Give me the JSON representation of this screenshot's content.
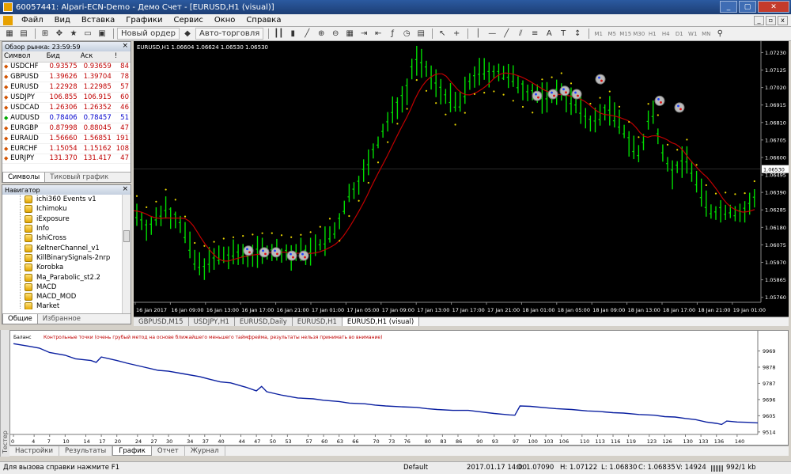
{
  "window": {
    "title": "60057441: Alpari-ECN-Demo - Демо Счет - [EURUSD,H1 (visual)]",
    "controls": [
      "_",
      "▢",
      "✕"
    ]
  },
  "menu": {
    "items": [
      "Файл",
      "Вид",
      "Вставка",
      "Графики",
      "Сервис",
      "Окно",
      "Справка"
    ],
    "mdi": [
      "_",
      "▫",
      "x"
    ]
  },
  "toolbar": {
    "new_order": "Новый ордер",
    "autotrade": "Авто-торговля",
    "timeframes": [
      "M1",
      "M5",
      "M15",
      "M30",
      "H1",
      "H4",
      "D1",
      "W1",
      "MN"
    ]
  },
  "market_watch": {
    "header": "Обзор рынка: 23:59:59",
    "columns": [
      "Символ",
      "Бид",
      "Аск",
      "!"
    ],
    "rows": [
      {
        "symbol": "USDCHF",
        "bid": "0.93575",
        "ask": "0.93659",
        "spread": "84"
      },
      {
        "symbol": "GBPUSD",
        "bid": "1.39626",
        "ask": "1.39704",
        "spread": "78"
      },
      {
        "symbol": "EURUSD",
        "bid": "1.22928",
        "ask": "1.22985",
        "spread": "57"
      },
      {
        "symbol": "USDJPY",
        "bid": "106.855",
        "ask": "106.915",
        "spread": "60"
      },
      {
        "symbol": "USDCAD",
        "bid": "1.26306",
        "ask": "1.26352",
        "spread": "46"
      },
      {
        "symbol": "AUDUSD",
        "bid": "0.78406",
        "ask": "0.78457",
        "spread": "51"
      },
      {
        "symbol": "EURGBP",
        "bid": "0.87998",
        "ask": "0.88045",
        "spread": "47"
      },
      {
        "symbol": "EURAUD",
        "bid": "1.56660",
        "ask": "1.56851",
        "spread": "191"
      },
      {
        "symbol": "EURCHF",
        "bid": "1.15054",
        "ask": "1.15162",
        "spread": "108"
      },
      {
        "symbol": "EURJPY",
        "bid": "131.370",
        "ask": "131.417",
        "spread": "47"
      }
    ],
    "tabs": [
      "Символы",
      "Тиковый график"
    ]
  },
  "navigator": {
    "header": "Навигатор",
    "items": [
      "ichi360 Events v1",
      "Ichimoku",
      "iExposure",
      "Info",
      "IshiCross",
      "KeltnerChannel_v1",
      "KillBinarySignals-2nrp",
      "Korobka",
      "Ma_Parabolic_st2.2",
      "MACD",
      "MACD_MOD",
      "Market"
    ],
    "tabs": [
      "Общие",
      "Избранное"
    ]
  },
  "chart": {
    "info": "EURUSD,H1  1.06604 1.06624 1.06530 1.06530",
    "price_labels": [
      "1.07230",
      "1.07125",
      "1.07020",
      "1.06915",
      "1.06810",
      "1.06705",
      "1.06600",
      "1.06530",
      "1.06495",
      "1.06390",
      "1.06285",
      "1.06180",
      "1.06075",
      "1.05970",
      "1.05865",
      "1.05760"
    ],
    "current_price": "1.06530",
    "time_labels": [
      "16 Jan 2017",
      "16 Jan 09:00",
      "16 Jan 13:00",
      "16 Jan 17:00",
      "16 Jan 21:00",
      "17 Jan 01:00",
      "17 Jan 05:00",
      "17 Jan 09:00",
      "17 Jan 13:00",
      "17 Jan 17:00",
      "17 Jan 21:00",
      "18 Jan 01:00",
      "18 Jan 05:00",
      "18 Jan 09:00",
      "18 Jan 13:00",
      "18 Jan 17:00",
      "18 Jan 21:00",
      "19 Jan 01:00"
    ],
    "colors": {
      "bg": "#000000",
      "candle": "#00dd00",
      "ma": "#c00000",
      "psar": "#e8d400",
      "trend": "#2040ff"
    },
    "tabs": [
      "GBPUSD,M15",
      "USDJPY,H1",
      "EURUSD,Daily",
      "EURUSD,H1",
      "EURUSD,H1 (visual)"
    ]
  },
  "chart_data": {
    "type": "line",
    "title": "Баланс",
    "note": "Контрольные точки (очень грубый метод на основе ближайшего меньшего таймфрейма, результаты нельзя принимать во внимание)",
    "x_ticks": [
      "0",
      "4",
      "7",
      "10",
      "14",
      "17",
      "20",
      "24",
      "27",
      "30",
      "34",
      "37",
      "40",
      "44",
      "47",
      "50",
      "53",
      "57",
      "60",
      "63",
      "66",
      "70",
      "73",
      "76",
      "80",
      "83",
      "86",
      "90",
      "93",
      "97",
      "100",
      "103",
      "106",
      "110",
      "113",
      "116",
      "119",
      "123",
      "126",
      "130",
      "133",
      "136",
      "140"
    ],
    "y_ticks": [
      "9969",
      "9878",
      "9787",
      "9696",
      "9605",
      "9514"
    ],
    "ylim": [
      9500,
      10020
    ],
    "xlim": [
      0,
      144
    ],
    "series": [
      {
        "name": "Баланс",
        "x": [
          0,
          3,
          5,
          7,
          10,
          12,
          15,
          16,
          17,
          20,
          22,
          25,
          28,
          30,
          33,
          36,
          38,
          40,
          42,
          45,
          47,
          48,
          49,
          52,
          55,
          58,
          60,
          63,
          65,
          68,
          70,
          72,
          75,
          78,
          80,
          82,
          85,
          88,
          90,
          93,
          96,
          97,
          98,
          100,
          103,
          105,
          108,
          111,
          113,
          116,
          118,
          121,
          124,
          126,
          128,
          130,
          132,
          134,
          136,
          137,
          138,
          140,
          142,
          144
        ],
        "y": [
          10010,
          9995,
          9985,
          9960,
          9945,
          9925,
          9915,
          9905,
          9935,
          9915,
          9900,
          9880,
          9860,
          9855,
          9840,
          9825,
          9810,
          9795,
          9790,
          9765,
          9745,
          9770,
          9740,
          9720,
          9705,
          9700,
          9692,
          9685,
          9676,
          9672,
          9665,
          9660,
          9655,
          9652,
          9645,
          9640,
          9635,
          9635,
          9628,
          9618,
          9610,
          9608,
          9660,
          9658,
          9650,
          9645,
          9640,
          9632,
          9630,
          9622,
          9620,
          9612,
          9608,
          9600,
          9598,
          9590,
          9583,
          9570,
          9562,
          9556,
          9575,
          9570,
          9568,
          9565
        ]
      }
    ]
  },
  "tester_tabs": [
    "Настройки",
    "Результаты",
    "График",
    "Отчет",
    "Журнал"
  ],
  "tester_label": "Тестер",
  "status": {
    "help": "Для вызова справки нажмите F1",
    "profile": "Default",
    "datetime": "2017.01.17 14:00",
    "open": "O: 1.07090",
    "high": "H: 1.07122",
    "low": "L: 1.06830",
    "close": "C: 1.06835",
    "volume": "V: 14924",
    "traffic": "992/1 kb"
  }
}
